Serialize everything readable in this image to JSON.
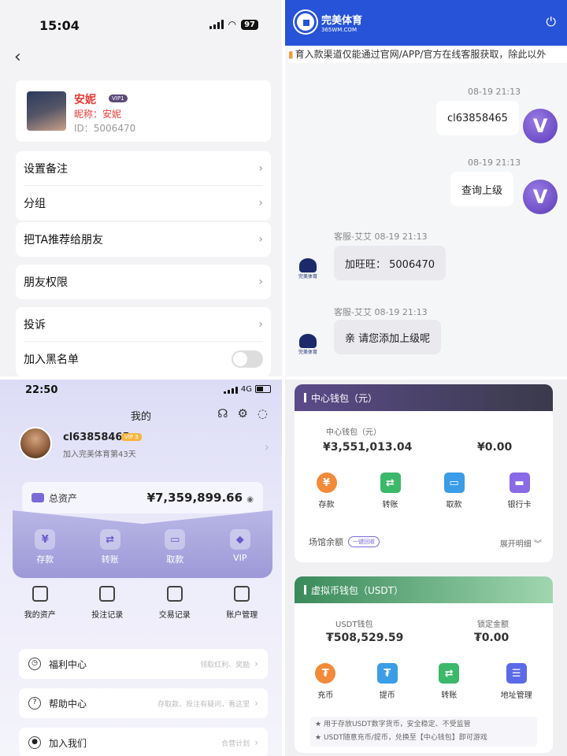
{
  "panel1": {
    "status_time": "15:04",
    "battery": "97",
    "profile": {
      "name": "安妮",
      "vip": "VIP1",
      "nickname": "昵称：安妮",
      "id": "ID：5006470"
    },
    "rows": [
      "设置备注",
      "分组",
      "把TA推荐给朋友",
      "朋友权限",
      "投诉",
      "加入黑名单"
    ]
  },
  "panel2": {
    "brand_title": "完美体育",
    "brand_domain": "365WM.COM",
    "notice": "育入款渠道仅能通过官网/APP/官方在线客服获取，除此以外",
    "messages": [
      {
        "time": "08-19 21:13",
        "text": "cl63858465"
      },
      {
        "time": "08-19 21:13",
        "text": "查询上级"
      },
      {
        "time": "客服-艾艾 08-19 21:13",
        "text": "加旺旺： 5006470"
      },
      {
        "time": "客服-艾艾 08-19 21:13",
        "text": "亲 请您添加上级呢"
      }
    ],
    "avatar_letter": "V",
    "cs_brand": "完美体育"
  },
  "panel3": {
    "status_time": "22:50",
    "network": "4G",
    "title": "我的",
    "username": "cl63858465",
    "vip": "VIP 3",
    "joined": "加入完美体育第43天",
    "total_assets_label": "总资产",
    "total_assets_value": "¥7,359,899.66",
    "wallet_buttons": [
      {
        "label": "存款",
        "icon": "¥"
      },
      {
        "label": "转账",
        "icon": "⇄"
      },
      {
        "label": "取款",
        "icon": "▭"
      },
      {
        "label": "VIP",
        "icon": "◆"
      }
    ],
    "quick_links": [
      "我的资产",
      "投注记录",
      "交易记录",
      "账户管理"
    ],
    "menu": [
      {
        "label": "福利中心",
        "hint": "领取红利、奖励"
      },
      {
        "label": "帮助中心",
        "hint": "存取款、投注有疑问，看这里"
      },
      {
        "label": "加入我们",
        "hint": "合营计划"
      }
    ]
  },
  "panel4": {
    "center_title": "中心钱包（元）",
    "center_wallet_label": "中心钱包（元）",
    "center_wallet_value": "¥3,551,013.04",
    "locked_value": "¥0.00",
    "center_buttons": [
      "存款",
      "转账",
      "取款",
      "银行卡"
    ],
    "arena_label": "场馆余额",
    "recover_label": "一键回收",
    "expand_label": "展开明细",
    "usdt_title": "虚拟币钱包（USDT）",
    "usdt_wallet_label": "USDT钱包",
    "usdt_wallet_value": "₮508,529.59",
    "usdt_locked_label": "锁定金额",
    "usdt_locked_value": "₮0.00",
    "usdt_buttons": [
      "充币",
      "提币",
      "转账",
      "地址管理"
    ],
    "tips": [
      "用于存放USDT数字货币，安全稳定、不受监管",
      "USDT随意充币/提币，兑换至【中心钱包】即可游戏"
    ]
  }
}
